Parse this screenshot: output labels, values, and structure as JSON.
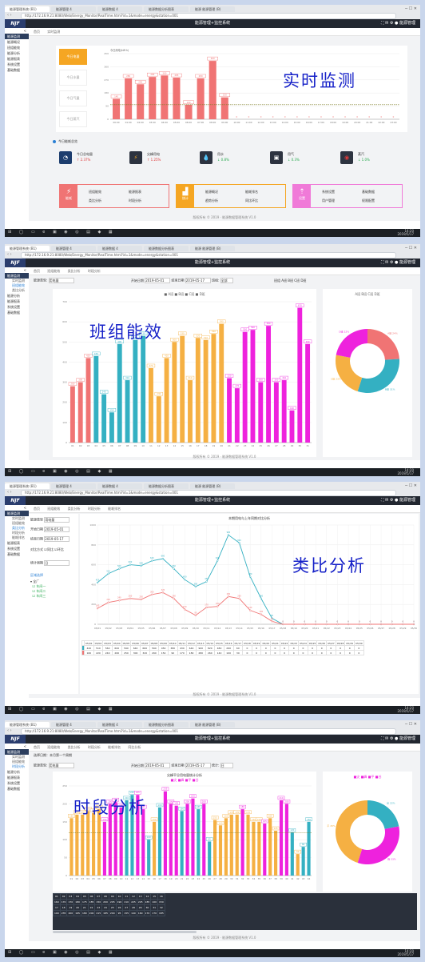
{
  "browser": {
    "tabs": [
      "能源管理系统 (B1)",
      "能源管理 4",
      "能源数据 4",
      "能源数据分析图表",
      "能源 能源管理 (B)"
    ],
    "url": "http://172.16.9.21:8080/Web/Energy_Monitor/RealTime.html?id=1&mode=energy&station=001",
    "window_controls": "─ ☐ ✕"
  },
  "app": {
    "logo": "NJF",
    "title": "能源管理+监控系统",
    "icons": "⛶  ✉  ⚙  ● 能源管理"
  },
  "taskbar": {
    "icons": "⊞ ◯ ▭ e ▣ ◉ ◎ ▤ ◆ ▦",
    "clock": "14:20\n2019/5/17"
  },
  "footer": "版权所有 © 2019 · 能源数据管理系统 V1.0",
  "panel1": {
    "caption": "实时监测",
    "sidebar": [
      "能源监测",
      "能源概况",
      "班组能效",
      "能源分析",
      "能源报表",
      "系统设置",
      "基础数据"
    ],
    "side_toggle": "<",
    "crumbs": [
      "首页",
      "实时监测"
    ],
    "buttons": [
      "今日电量",
      "今日水量",
      "今日气量",
      "今日蒸汽"
    ],
    "chart_title": "今日用电(kW·h)",
    "section": "今日能耗总览",
    "kpis": [
      {
        "icon": "◔",
        "label": "今日总电量",
        "value": "↑ 2.37%"
      },
      {
        "icon": "⚡",
        "label": "尖峰用电",
        "value": "↑ 1.25%"
      },
      {
        "icon": "💧",
        "label": "用水",
        "value": "↓ 0.8%"
      },
      {
        "icon": "▣",
        "label": "用气",
        "value": "↓ 0.3%"
      },
      {
        "icon": "◉",
        "label": "蒸汽",
        "value": "↓ 1.0%"
      }
    ],
    "quick": [
      {
        "title": "能耗",
        "sym": "⚡",
        "items": [
          "班组能效",
          "能源报表",
          "类比分析",
          "时段分析"
        ],
        "color": "#f07474"
      },
      {
        "title": "统计",
        "sym": "▟",
        "items": [
          "能源概况",
          "能耗排名",
          "趋势分析",
          "同比环比"
        ],
        "color": "#f5a623"
      },
      {
        "title": "设置",
        "sym": "⇡",
        "items": [
          "系统设置",
          "基础数据",
          "用户管理",
          "权限配置"
        ],
        "color": "#f07ad8"
      }
    ]
  },
  "panel2": {
    "caption": "班组能效",
    "sidebar_main": "能源监测",
    "sidebar_subs": [
      "实时监测",
      "班组能效",
      "类比分析"
    ],
    "sidebar": [
      "能源分析",
      "能源报表",
      "系统设置",
      "基础数据"
    ],
    "crumbs": [
      "首页",
      "班组能效",
      "类比分析",
      "时段分析"
    ],
    "form": {
      "l1": "能源类型:",
      "v1": "用电量",
      "l2": "开始日期",
      "v2": "2019-05-01",
      "l3": "结束日期",
      "v3": "2019-05-17",
      "l4": "班组:",
      "v4": "全部",
      "right": "班组 A班 B班 C班 D班"
    },
    "pie_legend": "A班 B班 C班 D班",
    "legend": "■ A班  ■ B班  ■ C班  ■ D班"
  },
  "panel3": {
    "caption": "类比分析",
    "sidebar_main": "能源监测",
    "sidebar_subs": [
      "实时监测",
      "班组能效",
      "类比分析",
      "时段分析",
      "能耗排名"
    ],
    "sidebar": [
      "能源报表",
      "系统设置",
      "基础数据"
    ],
    "crumbs": [
      "首页",
      "班组能效",
      "类比分析",
      "时段分析",
      "能耗排名"
    ],
    "form": [
      {
        "label": "能源类型",
        "value": "用电量"
      },
      {
        "label": "开始日期",
        "value": "2019-05-01"
      },
      {
        "label": "结束日期",
        "value": "2019-05-17"
      },
      {
        "label": "对比方式",
        "value": "☑同比 ☑环比"
      },
      {
        "label": "统计周期",
        "value": "日"
      }
    ],
    "tree_title": "区域选择",
    "tree": [
      "▾ 全厂",
      "  ☑ 车间一",
      "  ☑ 车间二",
      "  ☑ 车间三"
    ],
    "chart_title": "本期用电与上年同期对比分析"
  },
  "panel4": {
    "caption": "时段分析",
    "sidebar_main": "能源监测",
    "sidebar_subs": [
      "实时监测",
      "班组能效",
      "时段分析"
    ],
    "sidebar": [
      "能源分析",
      "能源报表",
      "系统设置",
      "基础数据"
    ],
    "crumbs": [
      "首页",
      "班组能效",
      "类比分析",
      "时段分析",
      "能耗排名",
      "同比分析"
    ],
    "filter_title": "选择日期：本月第一个周期",
    "form": {
      "l1": "能源类型:",
      "v1": "用电量",
      "l2": "开始日期",
      "v2": "2019-05-01",
      "l3": "结束日期",
      "v3": "2019-05-17",
      "l4": "统计:",
      "v4": "日"
    },
    "chart_title": "尖峰平谷用电量统计分析",
    "legend": "■尖 ■峰 ■平 ■谷",
    "pie_legend": "■尖 ■峰 ■平 ■谷"
  },
  "chart_data": [
    {
      "type": "bar",
      "title": "今日用电(kW·h)",
      "categories": [
        "00:00",
        "01:00",
        "02:00",
        "03:00",
        "04:00",
        "05:00",
        "06:00",
        "07:00",
        "08:00",
        "09:00",
        "10:00",
        "11:00",
        "12:00",
        "13:00",
        "14:00",
        "15:00",
        "16:00",
        "17:00",
        "18:00",
        "19:00",
        "20:00",
        "21:00",
        "22:00",
        "23:00"
      ],
      "values": [
        140,
        280,
        240,
        290,
        300,
        285,
        100,
        280,
        400,
        150,
        0,
        0,
        0,
        0,
        0,
        0,
        0,
        0,
        0,
        0,
        0,
        0,
        0,
        0
      ],
      "reference_line": 100,
      "ylim": [
        0,
        450
      ],
      "color": "#f07474"
    },
    {
      "type": "bar",
      "title": "",
      "categories": [
        "01",
        "02",
        "03",
        "04",
        "05",
        "06",
        "07",
        "08",
        "09",
        "10",
        "11",
        "12",
        "13",
        "14",
        "15",
        "16",
        "17",
        "18",
        "19",
        "20",
        "21",
        "22",
        "23",
        "24",
        "25",
        "26",
        "27",
        "28",
        "29",
        "30",
        "31"
      ],
      "values": [
        280,
        300,
        420,
        430,
        240,
        150,
        490,
        310,
        510,
        530,
        370,
        230,
        420,
        500,
        530,
        310,
        520,
        510,
        540,
        590,
        320,
        270,
        550,
        560,
        300,
        580,
        300,
        310,
        160,
        670,
        490
      ],
      "colors_by_team": [
        "#f07474",
        "#f07474",
        "#f07474",
        "#34b0c2",
        "#34b0c2",
        "#34b0c2",
        "#34b0c2",
        "#34b0c2",
        "#34b0c2",
        "#34b0c2",
        "#f5b043",
        "#f5b043",
        "#f5b043",
        "#f5b043",
        "#f5b043",
        "#f5b043",
        "#f5b043",
        "#f5b043",
        "#f5b043",
        "#f5b043",
        "#ee22dd",
        "#ee22dd",
        "#ee22dd",
        "#ee22dd",
        "#ee22dd",
        "#ee22dd",
        "#ee22dd",
        "#ee22dd",
        "#ee22dd",
        "#ee22dd",
        "#ee22dd"
      ],
      "ylim": [
        0,
        700
      ]
    },
    {
      "type": "pie",
      "title": "",
      "labels": [
        "A班",
        "B班",
        "C班",
        "D班"
      ],
      "values": [
        24,
        31,
        23,
        22
      ],
      "colors": [
        "#f07474",
        "#34b0c2",
        "#f5b043",
        "#ee22dd"
      ]
    },
    {
      "type": "line",
      "title": "本期用电与上年同期对比分析",
      "x": [
        "05/01",
        "05/02",
        "05/03",
        "05/04",
        "05/05",
        "05/06",
        "05/07",
        "05/08",
        "05/09",
        "05/10",
        "05/11",
        "05/12",
        "05/13",
        "05/14",
        "05/15",
        "05/16",
        "05/17",
        "05/18",
        "05/19",
        "05/20",
        "05/21",
        "05/22",
        "05/23",
        "05/24",
        "05/25",
        "05/26",
        "05/27",
        "05/28",
        "05/29",
        "05/30"
      ],
      "series": [
        {
          "values": [
            420,
            510,
            560,
            600,
            590,
            640,
            660,
            560,
            450,
            380,
            430,
            640,
            900,
            820,
            480,
            260,
            60,
            0,
            0,
            0,
            0,
            0,
            0,
            0,
            0,
            0,
            0,
            0,
            0,
            0
          ],
          "color": "#34b0c2"
        },
        {
          "values": [
            160,
            220,
            240,
            260,
            250,
            300,
            320,
            260,
            150,
            90,
            170,
            180,
            280,
            260,
            140,
            100,
            30,
            0,
            0,
            0,
            0,
            0,
            0,
            0,
            0,
            0,
            0,
            0,
            0,
            0
          ],
          "color": "#f07474"
        }
      ],
      "ylim": [
        0,
        1000
      ]
    },
    {
      "type": "bar",
      "title": "尖峰平谷用电量统计分析",
      "categories": [
        "01",
        "02",
        "03",
        "04",
        "05",
        "06",
        "07",
        "08",
        "09",
        "10",
        "11",
        "12",
        "13",
        "14",
        "15",
        "16",
        "17",
        "18",
        "19",
        "20",
        "21",
        "22",
        "23",
        "24",
        "25",
        "26",
        "27",
        "28",
        "29",
        "30",
        "31",
        "32",
        "33",
        "34",
        "35",
        "36",
        "37",
        "38",
        "39",
        "40",
        "41",
        "42",
        "43",
        "44"
      ],
      "values": [
        160,
        170,
        170,
        180,
        175,
        185,
        150,
        200,
        205,
        190,
        210,
        225,
        225,
        185,
        100,
        150,
        190,
        235,
        200,
        195,
        180,
        200,
        215,
        185,
        200,
        95,
        155,
        140,
        160,
        170,
        170,
        185,
        170,
        150,
        150,
        145,
        160,
        125,
        210,
        200,
        120,
        60,
        80,
        150
      ],
      "colors": [
        "#f5b043",
        "#f5b043",
        "#f5b043",
        "#f5b043",
        "#f5b043",
        "#f5b043",
        "#ee22dd",
        "#ee22dd",
        "#ee22dd",
        "#ee22dd",
        "#34b0c2",
        "#34b0c2",
        "#ee22dd",
        "#ee22dd",
        "#34b0c2",
        "#f5b043",
        "#34b0c2",
        "#ee22dd",
        "#ee22dd",
        "#ee22dd",
        "#34b0c2",
        "#ee22dd",
        "#ee22dd",
        "#34b0c2",
        "#ee22dd",
        "#34b0c2",
        "#f5b043",
        "#f5b043",
        "#f5b043",
        "#f5b043",
        "#f5b043",
        "#ee22dd",
        "#f5b043",
        "#f5b043",
        "#f5b043",
        "#ee22dd",
        "#f5b043",
        "#f5b043",
        "#ee22dd",
        "#ee22dd",
        "#34b0c2",
        "#f5b043",
        "#34b0c2",
        "#34b0c2"
      ],
      "reference_line": 120,
      "ylim": [
        0,
        250
      ]
    },
    {
      "type": "pie",
      "title": "",
      "labels": [
        "尖",
        "峰",
        "平",
        "谷"
      ],
      "values": [
        22,
        33,
        45,
        0
      ],
      "colors": [
        "#34b0c2",
        "#ee22dd",
        "#f5b043",
        "#f07474"
      ]
    }
  ]
}
